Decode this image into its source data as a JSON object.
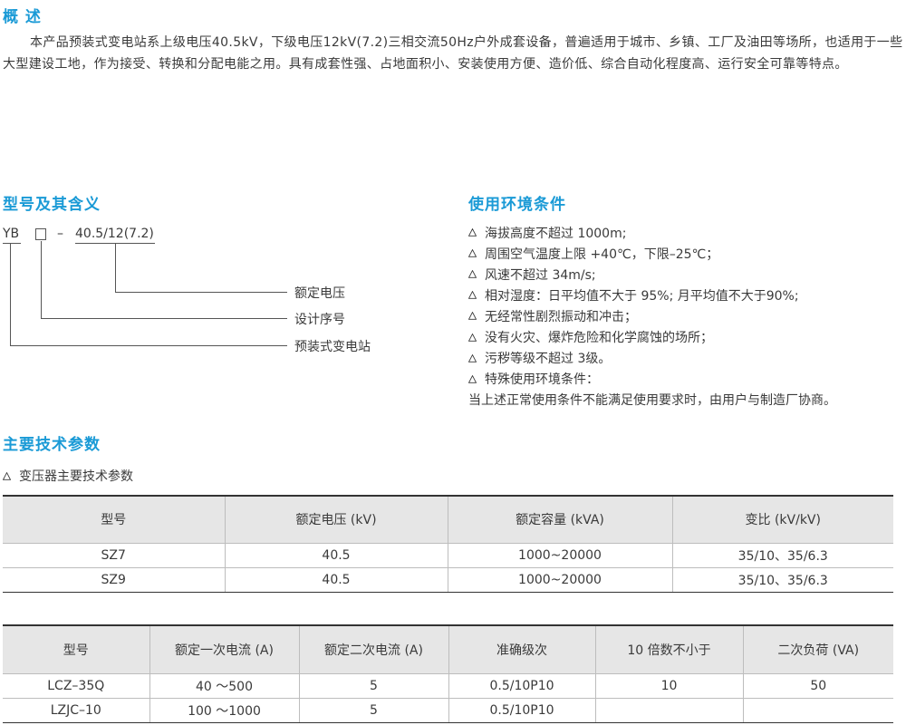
{
  "overview": {
    "heading": "概 述",
    "text": "本产品预装式变电站系上级电压40.5kV，下级电压12kV(7.2)三相交流50Hz户外成套设备，普遍适用于城市、乡镇、工厂及油田等场所，也适用于一些大型建设工地，作为接受、转换和分配电能之用。具有成套性强、占地面积小、安装使用方便、造价低、综合自动化程度高、运行安全可靠等特点。"
  },
  "model": {
    "heading": "型号及其含义",
    "prefix": "YB",
    "dash": "–",
    "voltage_code": "40.5/12(7.2)",
    "labels": [
      "额定电压",
      "设计序号",
      "预装式变电站"
    ]
  },
  "environment": {
    "heading": "使用环境条件",
    "conditions": [
      "海拔高度不超过 1000m;",
      "周围空气温度上限 +40℃，下限–25℃；",
      "风速不超过 34m/s;",
      "相对湿度：日平均值不大于 95%; 月平均值不大于90%;",
      "无经常性剧烈振动和冲击；",
      "没有火灾、爆炸危险和化学腐蚀的场所；",
      "污秽等级不超过 3级。",
      "特殊使用环境条件："
    ],
    "note": "当上述正常使用条件不能满足使用要求时，由用户与制造厂协商。"
  },
  "params": {
    "heading": "主要技术参数",
    "subheading": "变压器主要技术参数",
    "table1": {
      "headers": [
        "型号",
        "额定电压 (kV)",
        "额定容量 (kVA)",
        "变比 (kV/kV)"
      ],
      "rows": [
        [
          "SZ7",
          "40.5",
          "1000~20000",
          "35/10、35/6.3"
        ],
        [
          "SZ9",
          "40.5",
          "1000~20000",
          "35/10、35/6.3"
        ]
      ]
    },
    "table2": {
      "headers": [
        "型号",
        "额定一次电流 (A)",
        "额定二次电流 (A)",
        "准确级次",
        "10 倍数不小于",
        "二次负荷 (VA)"
      ],
      "rows": [
        [
          "LCZ–35Q",
          "40 ～500",
          "5",
          "0.5/10P10",
          "10",
          "50"
        ],
        [
          "LZJC–10",
          "100 ～1000",
          "5",
          "0.5/10P10",
          "",
          ""
        ]
      ]
    }
  },
  "colors": {
    "heading": "#1a9ad6",
    "header_bg": "#e6e6e6"
  }
}
